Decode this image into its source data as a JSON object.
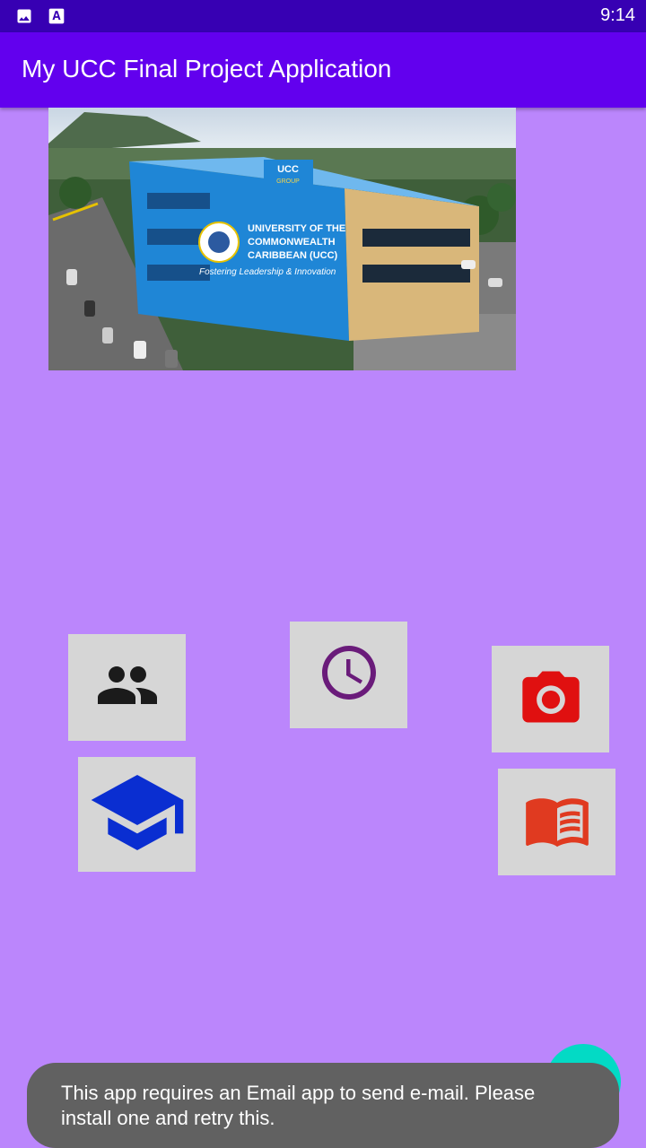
{
  "status_bar": {
    "time": "9:14",
    "icons": [
      "image-icon",
      "accessibility-text-icon"
    ]
  },
  "app_bar": {
    "title": "My UCC Final Project Application"
  },
  "hero": {
    "sign_text": "UCC",
    "sign_subtext": "GROUP",
    "banner_line1": "UNIVERSITY OF THE",
    "banner_line2": "COMMONWEALTH",
    "banner_line3": "CARIBBEAN (UCC)",
    "banner_tagline": "Fostering Leadership & Innovation"
  },
  "tiles": [
    {
      "name": "people",
      "icon": "people-icon",
      "color": "#1b1b1b"
    },
    {
      "name": "clock",
      "icon": "clock-icon",
      "color": "#6a1b7a"
    },
    {
      "name": "camera",
      "icon": "camera-icon",
      "color": "#e01010"
    },
    {
      "name": "graduation",
      "icon": "graduation-cap-icon",
      "color": "#0a2ed1"
    },
    {
      "name": "book",
      "icon": "book-icon",
      "color": "#e03a20"
    }
  ],
  "toast": {
    "message": "This app requires an Email app to send e-mail. Please install one and retry this."
  },
  "fab": {
    "icon": "email-icon",
    "color": "#03dac5"
  },
  "colors": {
    "background": "#bb86fc",
    "app_bar": "#6200ee",
    "status_bar": "#3700b3"
  }
}
